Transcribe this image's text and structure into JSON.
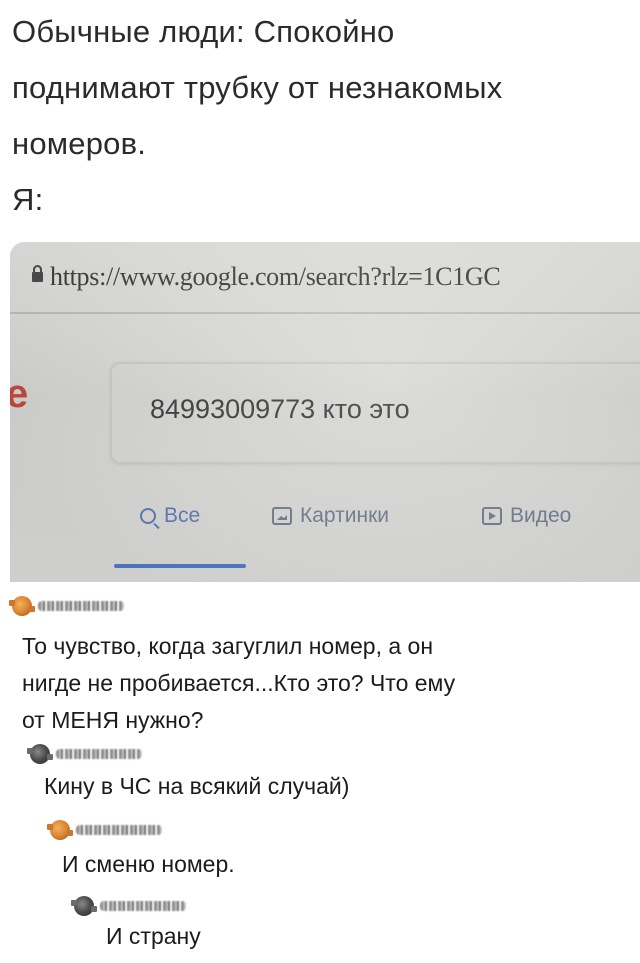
{
  "caption": {
    "lines": [
      "Обычные люди: Спокойно",
      "поднимают трубку от незнакомых",
      "номеров.",
      "Я:"
    ]
  },
  "browser": {
    "url": "https://www.google.com/search?rlz=1C1GC",
    "logo_fragment": "e",
    "search_query": "84993009773 кто это",
    "tabs": [
      {
        "label": "Все",
        "icon": "search-icon",
        "active": true
      },
      {
        "label": "Картинки",
        "icon": "image-icon",
        "active": false
      },
      {
        "label": "Видео",
        "icon": "video-icon",
        "active": false
      }
    ],
    "accent_color": "#4f7bc4"
  },
  "comments": [
    {
      "avatar_color": "orange",
      "lines": [
        "То чувство, когда загуглил номер, а он",
        "нигде не пробивается...Кто это? Что ему",
        "от МЕНЯ нужно?"
      ]
    },
    {
      "avatar_color": "gray",
      "lines": [
        "Кину в ЧС на всякий случай)"
      ]
    },
    {
      "avatar_color": "orange",
      "lines": [
        "И сменю номер."
      ]
    },
    {
      "avatar_color": "gray",
      "lines": [
        "И страну"
      ]
    }
  ]
}
